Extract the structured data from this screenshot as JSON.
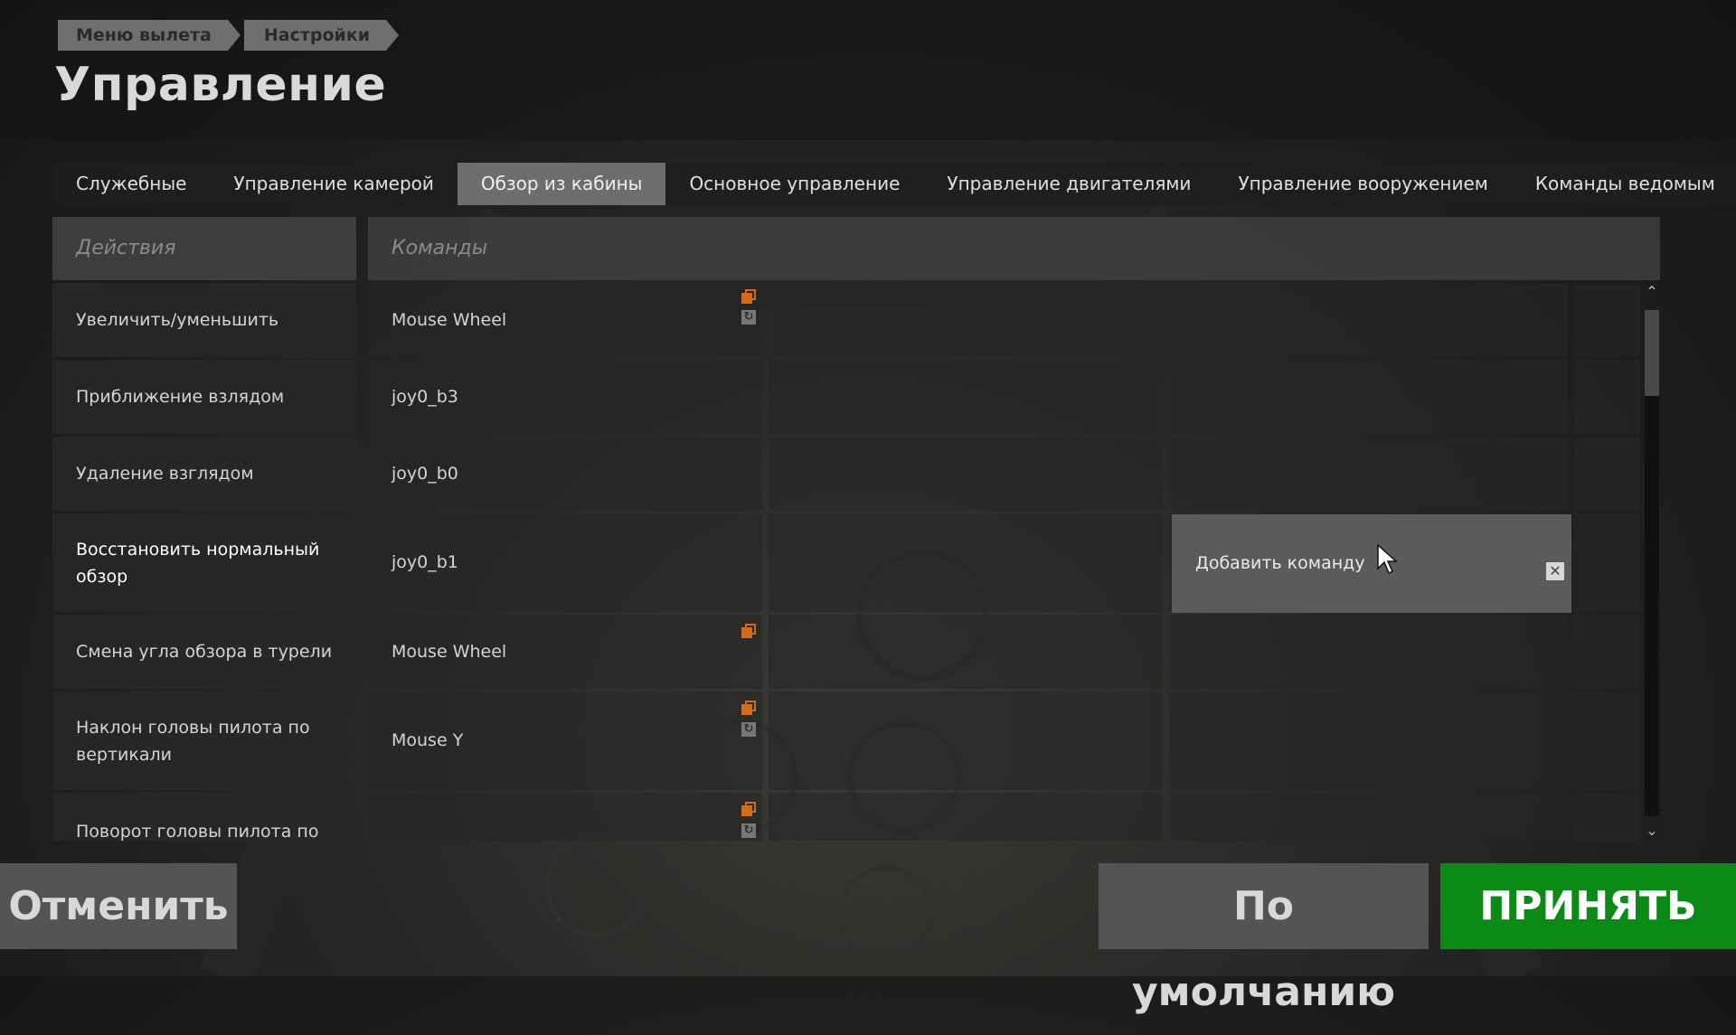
{
  "breadcrumb": [
    "Меню вылета",
    "Настройки"
  ],
  "page_title": "Управление",
  "tabs": [
    {
      "label": "Служебные",
      "active": false
    },
    {
      "label": "Управление камерой",
      "active": false
    },
    {
      "label": "Обзор из кабины",
      "active": true
    },
    {
      "label": "Основное управление",
      "active": false
    },
    {
      "label": "Управление двигателями",
      "active": false
    },
    {
      "label": "Управление вооружением",
      "active": false
    },
    {
      "label": "Команды ведомым",
      "active": false
    }
  ],
  "table": {
    "header_actions": "Действия",
    "header_commands": "Команды",
    "rows": [
      {
        "action": "Увеличить/уменьшить",
        "command": "Mouse Wheel"
      },
      {
        "action": "Приближение взлядом",
        "command": "joy0_b3"
      },
      {
        "action": "Удаление взглядом",
        "command": "joy0_b0"
      },
      {
        "action": "Восстановить нормальный обзор",
        "command": "joy0_b1"
      },
      {
        "action": "Смена угла обзора в турели",
        "command": "Mouse Wheel"
      },
      {
        "action": "Наклон головы пилота по вертикали",
        "command": "Mouse Y"
      },
      {
        "action": "Поворот головы пилота по",
        "command": ""
      }
    ]
  },
  "add_command_label": "Добавить команду",
  "icons": {
    "orange": "axis-settings-icon",
    "gray": "invert-axis-icon",
    "close": "close-icon"
  },
  "buttons": {
    "cancel": "Отменить",
    "default": "По умолчанию",
    "accept": "ПРИНЯТЬ"
  },
  "colors": {
    "accept": "#0c8a16",
    "icon_orange": "#d46a1c"
  }
}
